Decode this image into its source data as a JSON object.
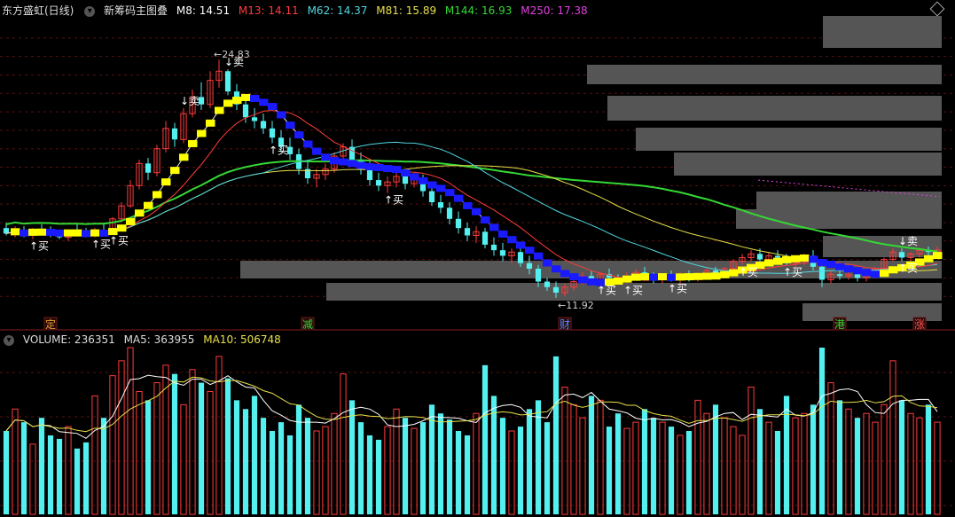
{
  "header": {
    "stock": "东方盛虹(日线)",
    "indicator": "新筹码主图叠",
    "ma": [
      {
        "label": "M8: 14.51",
        "color": "#ffffff"
      },
      {
        "label": "M13: 14.11",
        "color": "#ff3b3b"
      },
      {
        "label": "M62: 14.37",
        "color": "#4fd8e0"
      },
      {
        "label": "M81: 15.89",
        "color": "#e8e04a"
      },
      {
        "label": "M144: 16.93",
        "color": "#34d834"
      },
      {
        "label": "M250: 17.38",
        "color": "#e040e0"
      }
    ]
  },
  "volume_header": {
    "volume": "VOLUME: 236351",
    "ma5": "MA5: 363955",
    "ma10": "MA10: 506748"
  },
  "annotations": {
    "high": "24.83",
    "low": "11.92",
    "buy": "买",
    "sell": "卖"
  },
  "bottom_markers": [
    {
      "text": "定",
      "color": "#e8a030"
    },
    {
      "text": "减",
      "color": "#34d834"
    },
    {
      "text": "财",
      "color": "#4a8dff"
    },
    {
      "text": "港",
      "color": "#34d834"
    },
    {
      "text": "涨",
      "color": "#ff5050"
    }
  ],
  "chart_data": {
    "type": "candlestick",
    "price_range": [
      11.0,
      27.0
    ],
    "high_label": 24.83,
    "low_label": 11.92,
    "candles": [
      [
        15.7,
        16.0,
        15.3,
        15.4
      ],
      [
        15.4,
        15.8,
        15.2,
        15.6
      ],
      [
        15.6,
        15.8,
        15.2,
        15.3
      ],
      [
        15.3,
        15.7,
        15.1,
        15.6
      ],
      [
        15.6,
        15.9,
        15.3,
        15.5
      ],
      [
        15.5,
        15.8,
        15.2,
        15.4
      ],
      [
        15.4,
        15.6,
        15.1,
        15.2
      ],
      [
        15.2,
        15.6,
        15.0,
        15.5
      ],
      [
        15.5,
        15.9,
        15.3,
        15.4
      ],
      [
        15.4,
        15.7,
        15.2,
        15.3
      ],
      [
        15.3,
        15.7,
        15.2,
        15.6
      ],
      [
        15.6,
        16.0,
        15.4,
        15.5
      ],
      [
        15.5,
        16.3,
        15.4,
        16.2
      ],
      [
        16.2,
        17.1,
        16.0,
        16.9
      ],
      [
        16.9,
        18.3,
        16.8,
        18.0
      ],
      [
        18.0,
        19.4,
        17.8,
        19.2
      ],
      [
        19.2,
        19.5,
        18.3,
        18.7
      ],
      [
        18.7,
        20.2,
        18.5,
        20.0
      ],
      [
        20.0,
        21.5,
        19.8,
        21.1
      ],
      [
        21.1,
        21.4,
        20.1,
        20.5
      ],
      [
        20.5,
        22.2,
        20.3,
        21.9
      ],
      [
        21.9,
        23.2,
        21.7,
        22.8
      ],
      [
        22.8,
        23.6,
        22.1,
        22.4
      ],
      [
        22.4,
        24.2,
        22.2,
        23.7
      ],
      [
        23.7,
        24.83,
        23.3,
        24.2
      ],
      [
        24.2,
        24.3,
        22.9,
        23.1
      ],
      [
        23.1,
        23.5,
        22.1,
        22.4
      ],
      [
        22.4,
        22.8,
        21.4,
        21.7
      ],
      [
        21.7,
        22.2,
        21.1,
        21.5
      ],
      [
        21.5,
        21.9,
        20.8,
        21.1
      ],
      [
        21.1,
        21.5,
        20.3,
        20.6
      ],
      [
        20.6,
        21.0,
        19.8,
        20.1
      ],
      [
        20.1,
        20.6,
        19.4,
        19.7
      ],
      [
        19.7,
        20.0,
        18.6,
        18.9
      ],
      [
        18.9,
        19.4,
        18.1,
        18.4
      ],
      [
        18.4,
        18.9,
        17.9,
        18.6
      ],
      [
        18.6,
        19.2,
        18.3,
        18.9
      ],
      [
        18.9,
        19.8,
        18.7,
        19.6
      ],
      [
        19.6,
        20.3,
        19.2,
        20.1
      ],
      [
        20.1,
        20.5,
        19.1,
        19.4
      ],
      [
        19.4,
        19.8,
        18.6,
        18.9
      ],
      [
        18.9,
        19.3,
        18.0,
        18.3
      ],
      [
        18.3,
        18.7,
        17.7,
        18.0
      ],
      [
        18.0,
        18.5,
        17.6,
        18.2
      ],
      [
        18.2,
        18.8,
        17.9,
        18.5
      ],
      [
        18.5,
        18.9,
        17.8,
        18.1
      ],
      [
        18.1,
        18.7,
        17.9,
        18.4
      ],
      [
        18.4,
        18.6,
        17.4,
        17.7
      ],
      [
        17.7,
        18.0,
        16.9,
        17.1
      ],
      [
        17.1,
        17.5,
        16.5,
        16.8
      ],
      [
        16.8,
        17.1,
        15.9,
        16.2
      ],
      [
        16.2,
        16.6,
        15.4,
        15.7
      ],
      [
        15.7,
        16.0,
        15.0,
        15.3
      ],
      [
        15.3,
        15.8,
        14.9,
        15.5
      ],
      [
        15.5,
        15.7,
        14.6,
        14.8
      ],
      [
        14.8,
        15.2,
        14.2,
        14.5
      ],
      [
        14.5,
        14.9,
        13.9,
        14.2
      ],
      [
        14.2,
        14.6,
        13.8,
        14.4
      ],
      [
        14.4,
        14.6,
        13.6,
        13.8
      ],
      [
        13.8,
        14.2,
        13.2,
        13.5
      ],
      [
        13.5,
        13.7,
        12.5,
        12.8
      ],
      [
        12.8,
        13.0,
        12.3,
        12.5
      ],
      [
        12.5,
        12.8,
        11.92,
        12.2
      ],
      [
        12.2,
        12.7,
        12.0,
        12.5
      ],
      [
        12.5,
        13.0,
        12.3,
        12.8
      ],
      [
        12.8,
        13.3,
        12.6,
        13.1
      ],
      [
        13.1,
        13.4,
        12.7,
        12.9
      ],
      [
        12.9,
        13.3,
        12.7,
        13.2
      ],
      [
        13.2,
        13.5,
        12.9,
        13.0
      ],
      [
        13.0,
        13.2,
        12.7,
        12.9
      ],
      [
        12.9,
        13.3,
        12.7,
        13.1
      ],
      [
        13.1,
        13.5,
        12.9,
        13.3
      ],
      [
        13.3,
        13.6,
        12.9,
        13.0
      ],
      [
        13.0,
        13.3,
        12.7,
        12.9
      ],
      [
        12.9,
        13.2,
        12.7,
        13.1
      ],
      [
        13.1,
        13.4,
        12.8,
        12.9
      ],
      [
        12.9,
        13.3,
        12.7,
        13.2
      ],
      [
        13.2,
        13.4,
        12.8,
        13.0
      ],
      [
        13.0,
        13.3,
        12.8,
        13.2
      ],
      [
        13.2,
        13.5,
        12.9,
        13.4
      ],
      [
        13.4,
        13.6,
        13.0,
        13.1
      ],
      [
        13.1,
        13.6,
        13.0,
        13.5
      ],
      [
        13.5,
        14.0,
        13.4,
        13.9
      ],
      [
        13.9,
        14.3,
        13.7,
        14.1
      ],
      [
        14.1,
        14.5,
        13.9,
        14.3
      ],
      [
        14.3,
        14.6,
        13.9,
        14.0
      ],
      [
        14.0,
        14.4,
        13.8,
        14.2
      ],
      [
        14.2,
        14.5,
        13.9,
        14.1
      ],
      [
        14.1,
        14.3,
        13.7,
        13.8
      ],
      [
        13.8,
        14.1,
        13.5,
        13.9
      ],
      [
        13.9,
        14.3,
        13.7,
        14.2
      ],
      [
        14.2,
        14.5,
        13.4,
        13.6
      ],
      [
        13.6,
        13.8,
        12.5,
        12.9
      ],
      [
        12.9,
        13.4,
        12.7,
        13.2
      ],
      [
        13.2,
        13.5,
        12.9,
        13.1
      ],
      [
        13.1,
        13.4,
        12.9,
        13.2
      ],
      [
        13.2,
        13.4,
        12.8,
        13.0
      ],
      [
        13.0,
        13.3,
        12.8,
        13.1
      ],
      [
        13.1,
        13.6,
        13.0,
        13.5
      ],
      [
        13.5,
        14.1,
        13.4,
        14.0
      ],
      [
        14.0,
        14.6,
        13.9,
        14.4
      ],
      [
        14.4,
        14.6,
        13.9,
        14.1
      ],
      [
        14.1,
        14.4,
        13.9,
        14.3
      ],
      [
        14.3,
        14.6,
        14.1,
        14.5
      ],
      [
        14.5,
        14.7,
        14.2,
        14.4
      ],
      [
        14.4,
        14.7,
        14.2,
        14.51
      ]
    ],
    "volume_max": 1800000,
    "volumes": [
      950,
      1200,
      1050,
      800,
      1100,
      900,
      860,
      1000,
      750,
      820,
      1350,
      1100,
      1580,
      1750,
      1900,
      1400,
      1300,
      1500,
      1700,
      1600,
      1250,
      1650,
      1500,
      1400,
      1800,
      1550,
      1300,
      1200,
      1350,
      1100,
      950,
      1050,
      900,
      1250,
      1100,
      950,
      1000,
      1150,
      1600,
      1300,
      1050,
      900,
      850,
      1000,
      1200,
      1100,
      980,
      1050,
      1250,
      1150,
      1080,
      950,
      900,
      1150,
      1700,
      1350,
      1100,
      950,
      1000,
      1200,
      1300,
      1050,
      1800,
      1450,
      1250,
      1100,
      1350,
      1300,
      1000,
      1150,
      980,
      1050,
      1200,
      1100,
      1050,
      1000,
      900,
      950,
      1300,
      1150,
      1250,
      1100,
      1000,
      900,
      1450,
      1200,
      1050,
      950,
      1350,
      1100,
      1150,
      1250,
      1900,
      1500,
      1300,
      1200,
      1100,
      1150,
      1050,
      1250,
      1750,
      1300,
      1150,
      1100,
      1250,
      1050
    ],
    "volume_ma5_line": "white",
    "volume_ma10_line": "yellow"
  }
}
